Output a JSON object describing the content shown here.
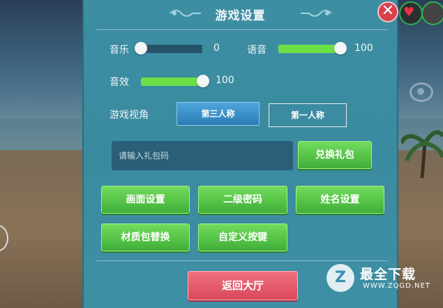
{
  "panel": {
    "title": "游戏设置",
    "close_icon": "close-icon"
  },
  "audio": {
    "music": {
      "label": "音乐",
      "value": "0",
      "level": 0
    },
    "voice": {
      "label": "语音",
      "value": "100",
      "level": 100
    },
    "sfx": {
      "label": "音效",
      "value": "100",
      "level": 100
    }
  },
  "view": {
    "label": "游戏视角",
    "options": [
      "第三人称",
      "第一人称"
    ],
    "selected": "第三人称"
  },
  "gift": {
    "placeholder": "请输入礼包码",
    "redeem_label": "兑换礼包"
  },
  "buttons": {
    "display_settings": "画面设置",
    "second_password": "二级密码",
    "name_settings": "姓名设置",
    "texture_pack": "材质包替换",
    "custom_keys": "自定义按键",
    "back_to_lobby": "返回大厅"
  },
  "watermark": {
    "title": "最全下载",
    "site": "WWW.ZQGD.NET"
  },
  "colors": {
    "panel": "#3e8ea3",
    "green": "#5cc94a",
    "red": "#e05a69",
    "blue": "#3a92cb"
  }
}
